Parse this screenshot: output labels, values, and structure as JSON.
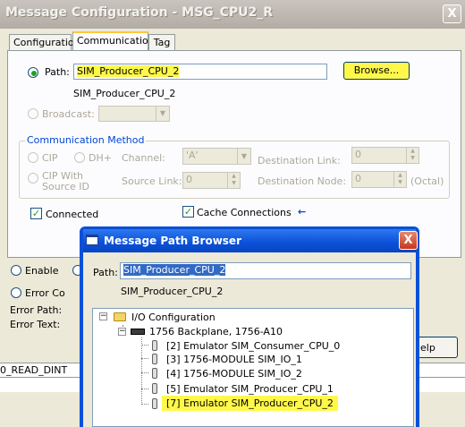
{
  "window": {
    "title": "Message Configuration - MSG_CPU2_R",
    "close_glyph": "X"
  },
  "tabs": [
    {
      "label": "Configuration",
      "active": false
    },
    {
      "label": "Communication",
      "active": true
    },
    {
      "label": "Tag",
      "active": false
    }
  ],
  "communication": {
    "path_label": "Path:",
    "path_value": "SIM_Producer_CPU_2",
    "path_resolved": "SIM_Producer_CPU_2",
    "browse_label": "Browse...",
    "broadcast_label": "Broadcast:",
    "method_group_label": "Communication Method",
    "cip_label": "CIP",
    "dhplus_label": "DH+",
    "channel_label": "Channel:",
    "channel_value": "'A'",
    "destination_link_label": "Destination Link:",
    "destination_link_value": "0",
    "cip_source_id_label_1": "CIP With",
    "cip_source_id_label_2": "Source ID",
    "source_link_label": "Source Link:",
    "source_link_value": "0",
    "destination_node_label": "Destination Node:",
    "destination_node_value": "0",
    "octal_label": "(Octal)",
    "connected_label": "Connected",
    "connected_checked": true,
    "cache_label": "Cache Connections",
    "cache_checked": true,
    "arrow_glyph": "←"
  },
  "lower": {
    "enable_label": "Enable",
    "error_code_label": "Error Co",
    "error_path_label": "Error Path:",
    "error_text_label": "Error Text:",
    "help_fragment": "elp",
    "tag_fragment": "0_READ_DINT"
  },
  "dialog": {
    "title": "Message Path Browser",
    "close_glyph": "X",
    "path_label": "Path:",
    "path_value": "SIM_Producer_CPU_2",
    "path_resolved": "SIM_Producer_CPU_2",
    "tree": {
      "root": "I/O Configuration",
      "backplane": "1756 Backplane, 1756-A10",
      "modules": [
        "[2] Emulator SIM_Consumer_CPU_0",
        "[3] 1756-MODULE SIM_IO_1",
        "[4] 1756-MODULE SIM_IO_2",
        "[5] Emulator SIM_Producer_CPU_1",
        "[7] Emulator SIM_Producer_CPU_2"
      ],
      "selected_index": 4,
      "expander_glyph": "−"
    }
  },
  "colors": {
    "highlight": "#fff84a",
    "accent_tab": "#ffc83c",
    "dialog_title": "#0a50d8"
  }
}
